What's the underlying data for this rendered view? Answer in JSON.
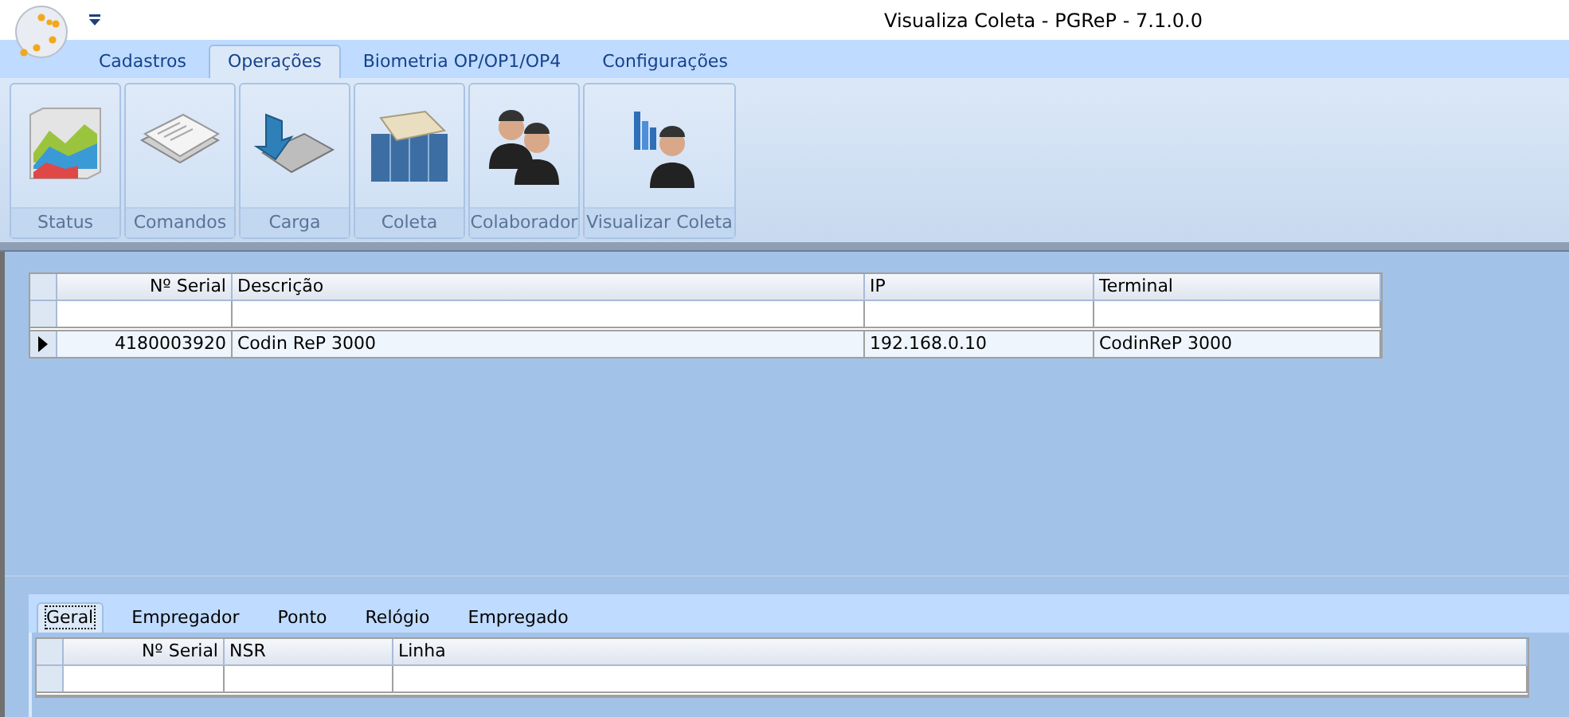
{
  "window": {
    "title": "Visualiza Coleta - PGReP - 7.1.0.0"
  },
  "ribbon_tabs": [
    {
      "label": "Cadastros",
      "selected": false
    },
    {
      "label": "Operações",
      "selected": true
    },
    {
      "label": "Biometria OP/OP1/OP4",
      "selected": false
    },
    {
      "label": "Configurações",
      "selected": false
    }
  ],
  "ribbon_buttons": [
    {
      "label": "Status",
      "kind": "chart"
    },
    {
      "label": "Comandos",
      "kind": "papers"
    },
    {
      "label": "Carga",
      "kind": "arrow"
    },
    {
      "label": "Coleta",
      "kind": "server"
    },
    {
      "label": "Colaborador",
      "kind": "people"
    },
    {
      "label": "Visualizar Coleta",
      "kind": "person-chart"
    }
  ],
  "terminal_grid": {
    "columns": [
      "Nº Serial",
      "Descrição",
      "IP",
      "Terminal"
    ],
    "rows": [
      {
        "cells": [
          "4180003920",
          "Codin ReP 3000",
          "192.168.0.10",
          "CodinReP 3000"
        ],
        "selected": true
      }
    ]
  },
  "detail_tabs": [
    {
      "label": "Geral",
      "selected": true
    },
    {
      "label": "Empregador",
      "selected": false
    },
    {
      "label": "Ponto",
      "selected": false
    },
    {
      "label": "Relógio",
      "selected": false
    },
    {
      "label": "Empregado",
      "selected": false
    }
  ],
  "detail_grid": {
    "columns": [
      "Nº Serial",
      "NSR",
      "Linha"
    ]
  }
}
